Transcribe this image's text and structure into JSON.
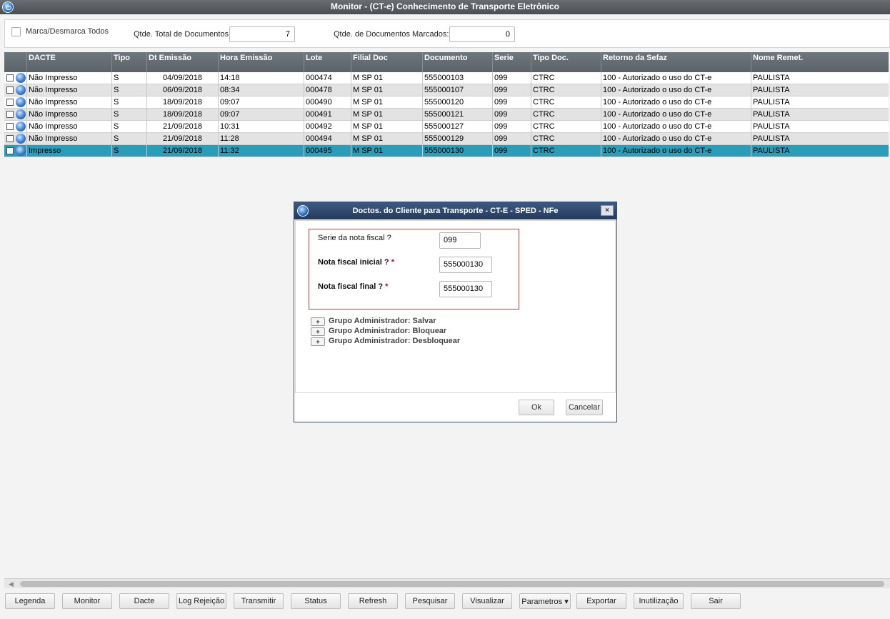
{
  "window": {
    "title": "Monitor - (CT-e) Conhecimento de Transporte Eletrônico"
  },
  "header": {
    "marca_label": "Marca/Desmarca Todos",
    "total_label": "Qtde. Total de Documentos:",
    "total_value": "7",
    "marcados_label": "Qtde. de Documentos Marcados:",
    "marcados_value": "0"
  },
  "grid": {
    "columns": [
      "DACTE",
      "Tipo",
      "Dt Emissão",
      "Hora Emissão",
      "Lote",
      "Filial Doc",
      "Documento",
      "Serie",
      "Tipo Doc.",
      "Retorno da Sefaz",
      "Nome Remet."
    ],
    "rows": [
      [
        "Não Impresso",
        "S",
        "04/09/2018",
        "14:18",
        "000474",
        "M SP 01",
        "555000103",
        "099",
        "CTRC",
        "100 - Autorizado o uso do CT-e",
        "PAULISTA"
      ],
      [
        "Não Impresso",
        "S",
        "06/09/2018",
        "08:34",
        "000478",
        "M SP 01",
        "555000107",
        "099",
        "CTRC",
        "100 - Autorizado o uso do CT-e",
        "PAULISTA"
      ],
      [
        "Não Impresso",
        "S",
        "18/09/2018",
        "09:07",
        "000490",
        "M SP 01",
        "555000120",
        "099",
        "CTRC",
        "100 - Autorizado o uso do CT-e",
        "PAULISTA"
      ],
      [
        "Não Impresso",
        "S",
        "18/09/2018",
        "09:07",
        "000491",
        "M SP 01",
        "555000121",
        "099",
        "CTRC",
        "100 - Autorizado o uso do CT-e",
        "PAULISTA"
      ],
      [
        "Não Impresso",
        "S",
        "21/09/2018",
        "10:31",
        "000492",
        "M SP 01",
        "555000127",
        "099",
        "CTRC",
        "100 - Autorizado o uso do CT-e",
        "PAULISTA"
      ],
      [
        "Não Impresso",
        "S",
        "21/09/2018",
        "11:28",
        "000494",
        "M SP 01",
        "555000129",
        "099",
        "CTRC",
        "100 - Autorizado o uso do CT-e",
        "PAULISTA"
      ],
      [
        "Impresso",
        "S",
        "21/09/2018",
        "11:32",
        "000495",
        "M SP 01",
        "555000130",
        "099",
        "CTRC",
        "100 - Autorizado o uso do CT-e",
        "PAULISTA"
      ]
    ],
    "selected_row": 6
  },
  "dialog": {
    "title": "Doctos. do Cliente para Transporte - CT-E - SPED - NFe",
    "close_glyph": "×",
    "serie_label": "Serie da nota fiscal ?",
    "serie_value": "099",
    "nf_inicial_label": "Nota fiscal inicial ?",
    "nf_inicial_value": "555000130",
    "nf_final_label": "Nota fiscal final ?",
    "nf_final_value": "555000130",
    "required_mark": "*",
    "grupos": [
      "Grupo Administrador: Salvar",
      "Grupo Administrador: Bloquear",
      "Grupo Administrador: Desbloquear"
    ],
    "expand_glyph": "+",
    "ok_label": "Ok",
    "cancel_label": "Cancelar"
  },
  "toolbar": {
    "buttons": [
      "Legenda",
      "Monitor",
      "Dacte",
      "Log Rejeição",
      "Transmitir",
      "Status",
      "Refresh",
      "Pesquisar",
      "Visualizar",
      "Parametros",
      "Exportar",
      "Inutilização",
      "Sair"
    ]
  },
  "colors": {
    "selected_row": "#2a9dbb",
    "header_bg": "#5b6369",
    "dialog_title_bg": "#243a5c",
    "required": "#d0021b"
  }
}
